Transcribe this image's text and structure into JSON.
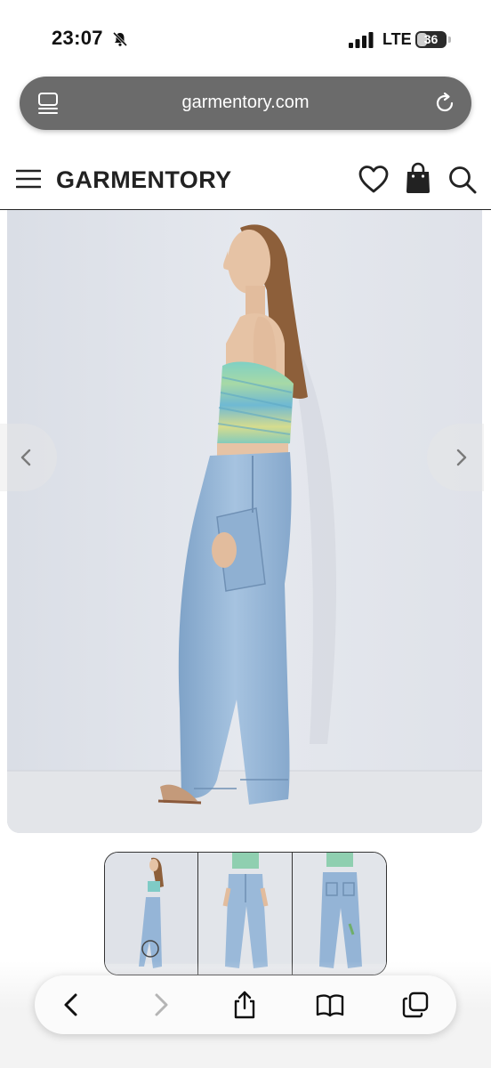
{
  "status_bar": {
    "time": "23:07",
    "network": "LTE",
    "battery_level": "36",
    "battery_fraction": 0.36,
    "icons": [
      "bell-muted-icon",
      "signal-icon"
    ]
  },
  "browser": {
    "url": "garmentory.com",
    "icons": [
      "tabs-list-icon",
      "reload-icon"
    ]
  },
  "site_header": {
    "brand": "GARMENTORY",
    "icons": [
      "menu-icon",
      "heart-icon",
      "bag-icon",
      "search-icon"
    ]
  },
  "gallery": {
    "prev_icon": "chevron-left-icon",
    "next_icon": "chevron-right-icon",
    "thumbnail_count": 3,
    "selected_thumbnail": 1
  },
  "toolbar": {
    "icons": [
      "back-icon",
      "forward-icon",
      "share-icon",
      "bookmarks-icon",
      "tabs-icon"
    ]
  },
  "colors": {
    "address_bar": "#6b6b6b",
    "denim": "#9ab8d8",
    "backdrop": "#e1e4ea"
  }
}
